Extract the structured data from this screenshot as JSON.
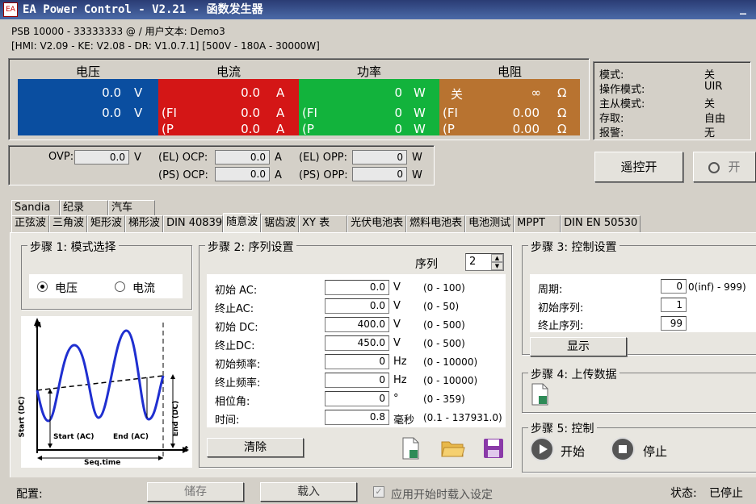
{
  "window": {
    "title": "EA Power Control - V2.21 - 函数发生器",
    "logo": "EA",
    "minimize": "_"
  },
  "device": {
    "line1": "PSB 10000 - 33333333 @ / 用户文本: Demo3",
    "line2": "[HMI: V2.09 - KE: V2.08 - DR: V1.0.7.1] [500V - 180A - 30000W]"
  },
  "meters": {
    "voltage": {
      "header": "电压",
      "value": "0.0",
      "set": "0.0",
      "unit": "V"
    },
    "current": {
      "header": "电流",
      "value": "0.0",
      "fi": "0.0",
      "p": "0.0",
      "unit": "A",
      "fi_label": "(FI",
      "p_label": "(P"
    },
    "power": {
      "header": "功率",
      "value": "0",
      "fi": "0",
      "p": "0",
      "unit": "W",
      "fi_label": "(FI",
      "p_label": "(P"
    },
    "resistance": {
      "header": "电阻",
      "state": "关",
      "value": "∞",
      "fi": "0.00",
      "p": "0.00",
      "unit": "Ω",
      "unit2": "Ω",
      "fi_label": "(FI",
      "p_label": "(P"
    }
  },
  "status": {
    "mode_label": "模式:",
    "mode": "关",
    "op_label": "操作模式:",
    "op": "UIR",
    "ms_label": "主从模式:",
    "ms": "关",
    "access_label": "存取:",
    "access": "自由",
    "alarm_label": "报警:",
    "alarm": "无"
  },
  "protection": {
    "ovp_label": "OVP:",
    "ovp": "0.0",
    "ovp_unit": "V",
    "el_ocp_label": "(EL) OCP:",
    "el_ocp": "0.0",
    "ps_ocp_label": "(PS) OCP:",
    "ps_ocp": "0.0",
    "a_unit": "A",
    "el_opp_label": "(EL) OPP:",
    "el_opp": "0",
    "ps_opp_label": "(PS) OPP:",
    "ps_opp": "0",
    "w_unit": "W"
  },
  "remote": {
    "remote_label": "遥控开",
    "on_label": "开"
  },
  "tabs_top": [
    "Sandia",
    "纪录",
    "汽车"
  ],
  "tabs": [
    "正弦波",
    "三角波",
    "矩形波",
    "梯形波",
    "DIN 40839",
    "随意波",
    "锯齿波",
    "XY 表",
    "光伏电池表",
    "燃料电池表",
    "电池测试",
    "MPPT",
    "DIN EN 50530"
  ],
  "step1": {
    "title": "步骤 1: 模式选择",
    "voltage": "电压",
    "current": "电流"
  },
  "diagram": {
    "y": "A",
    "t": "t",
    "start_dc": "Start (DC)",
    "end_dc": "End (DC)",
    "start_ac": "Start (AC)",
    "end_ac": "End (AC)",
    "seq": "Seq.time"
  },
  "step2": {
    "title": "步骤 2: 序列设置",
    "seq_label": "序列",
    "seq": "2",
    "clear": "清除",
    "rows": [
      {
        "label": "初始 AC:",
        "value": "0.0",
        "unit": "V",
        "range": "(0 - 100)"
      },
      {
        "label": "终止AC:",
        "value": "0.0",
        "unit": "V",
        "range": "(0 - 50)"
      },
      {
        "label": "初始 DC:",
        "value": "400.0",
        "unit": "V",
        "range": "(0 - 500)"
      },
      {
        "label": "终止DC:",
        "value": "450.0",
        "unit": "V",
        "range": "(0 - 500)"
      },
      {
        "label": "初始频率:",
        "value": "0",
        "unit": "Hz",
        "range": "(0 - 10000)"
      },
      {
        "label": "终止频率:",
        "value": "0",
        "unit": "Hz",
        "range": "(0 - 10000)"
      },
      {
        "label": "相位角:",
        "value": "0",
        "unit": "°",
        "range": "(0 - 359)"
      },
      {
        "label": "时间:",
        "value": "0.8",
        "unit": "毫秒",
        "range": "(0.1 - 137931.0)"
      }
    ]
  },
  "step3": {
    "title": "步骤 3: 控制设置",
    "period_label": "周期:",
    "period": "0",
    "period_range": "0(inf) - 999)",
    "start_label": "初始序列:",
    "start": "1",
    "end_label": "终止序列:",
    "end": "99",
    "show": "显示"
  },
  "step4": {
    "title": "步骤 4: 上传数据"
  },
  "step5": {
    "title": "步骤 5: 控制",
    "start": "开始",
    "stop": "停止"
  },
  "footer": {
    "config_label": "配置:",
    "save": "储存",
    "load": "载入",
    "apply": "应用开始时载入设定",
    "state_label": "状态:",
    "state": "已停止"
  }
}
